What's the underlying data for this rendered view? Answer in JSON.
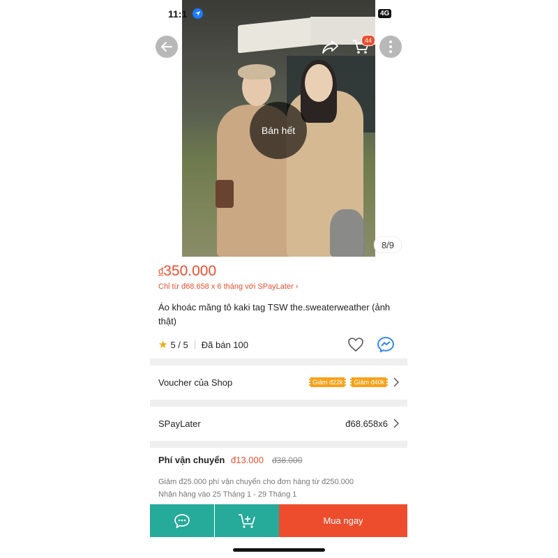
{
  "status_bar": {
    "time": "11:1",
    "network": "4G"
  },
  "gallery": {
    "sold_out_label": "Bán hết",
    "counter": "8/9",
    "cart_count": "44"
  },
  "product": {
    "currency": "đ",
    "price": "350.000",
    "installment": "Chỉ từ đ68.658 x 6 tháng với SPayLater ›",
    "title": "Áo khoác măng tô kaki tag TSW the.sweaterweather (ảnh thật)",
    "rating": "5 / 5",
    "sold": "Đã bán 100"
  },
  "voucher": {
    "label": "Voucher của Shop",
    "tags": [
      "Giảm đ22k",
      "Giảm đ40k"
    ]
  },
  "spaylater": {
    "label": "SPayLater",
    "value": "đ68.658x6"
  },
  "shipping": {
    "label": "Phí vận chuyển",
    "price": "đ13.000",
    "old_price": "đ38.000",
    "note1": "Giảm đ25.000 phí vận chuyển cho đơn hàng từ đ250.000",
    "note2": "Nhận hàng vào 25 Tháng 1 - 29 Tháng 1"
  },
  "bottom_bar": {
    "buy_now": "Mua ngay"
  },
  "colors": {
    "accent": "#ee4d2d",
    "teal": "#26aa99",
    "voucher": "#f7a21b"
  },
  "icons": [
    "back-arrow-icon",
    "share-icon",
    "cart-icon",
    "more-icon",
    "star-icon",
    "heart-icon",
    "messenger-icon",
    "chevron-right-icon",
    "chat-icon",
    "add-to-cart-icon",
    "location-icon"
  ]
}
